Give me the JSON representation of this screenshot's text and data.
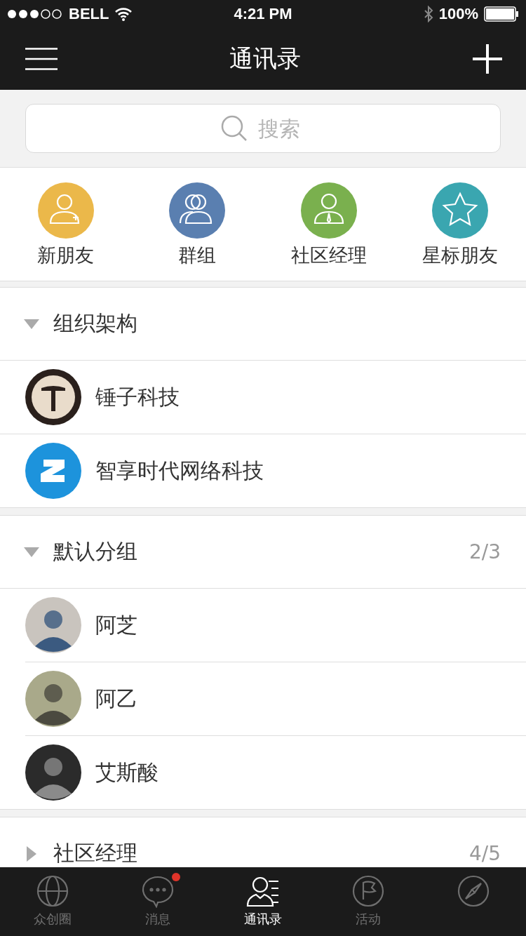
{
  "status_bar": {
    "carrier": "BELL",
    "time": "4:21 PM",
    "battery": "100%"
  },
  "nav": {
    "title": "通讯录"
  },
  "search": {
    "placeholder": "搜索"
  },
  "quick_entries": [
    {
      "label": "新朋友",
      "kind": "new-friend",
      "color": "#ebb84a"
    },
    {
      "label": "群组",
      "kind": "group",
      "color": "#5a7fb0"
    },
    {
      "label": "社区经理",
      "kind": "manager",
      "color": "#7ab04e"
    },
    {
      "label": "星标朋友",
      "kind": "star",
      "color": "#3aa6b0"
    }
  ],
  "groups": [
    {
      "name": "组织架构",
      "expanded": true,
      "members": [
        {
          "name": "锤子科技",
          "kind": "hammer-logo"
        },
        {
          "name": "智享时代网络科技",
          "kind": "z-logo"
        }
      ]
    },
    {
      "name": "默认分组",
      "count": "2/3",
      "expanded": true,
      "members": [
        {
          "name": "阿芝",
          "kind": "avatar"
        },
        {
          "name": "阿乙",
          "kind": "avatar"
        },
        {
          "name": "艾斯酸",
          "kind": "avatar"
        }
      ]
    },
    {
      "name": "社区经理",
      "count": "4/5",
      "expanded": false
    }
  ],
  "tabs": [
    {
      "label": "众创圈",
      "kind": "globe",
      "selected": false,
      "badge": false
    },
    {
      "label": "消息",
      "kind": "chat",
      "selected": false,
      "badge": true
    },
    {
      "label": "通讯录",
      "kind": "contacts",
      "selected": true,
      "badge": false
    },
    {
      "label": "活动",
      "kind": "flag",
      "selected": false,
      "badge": false
    },
    {
      "kind": "compass",
      "selected": false,
      "badge": false
    }
  ]
}
